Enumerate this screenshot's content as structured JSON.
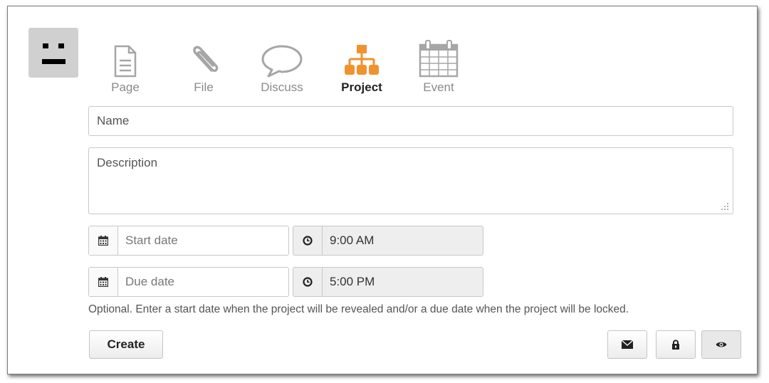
{
  "tabs": [
    {
      "label": "Page",
      "icon": "page-icon"
    },
    {
      "label": "File",
      "icon": "paperclip-icon"
    },
    {
      "label": "Discuss",
      "icon": "speech-bubble-icon"
    },
    {
      "label": "Project",
      "icon": "hierarchy-icon",
      "active": true
    },
    {
      "label": "Event",
      "icon": "calendar-icon"
    }
  ],
  "form": {
    "name_placeholder": "Name",
    "description_placeholder": "Description",
    "start_date_placeholder": "Start date",
    "start_time": "9:00 AM",
    "due_date_placeholder": "Due date",
    "due_time": "5:00 PM",
    "help_text": "Optional. Enter a start date when the project will be revealed and/or a due date when the project will be locked."
  },
  "actions": {
    "create_label": "Create",
    "icons": [
      "envelope-icon",
      "lock-icon",
      "eye-icon"
    ]
  },
  "colors": {
    "active_tab": "#f0922e",
    "inactive_icon": "#a6a6a6",
    "avatar_bg": "#d0d0d0"
  }
}
